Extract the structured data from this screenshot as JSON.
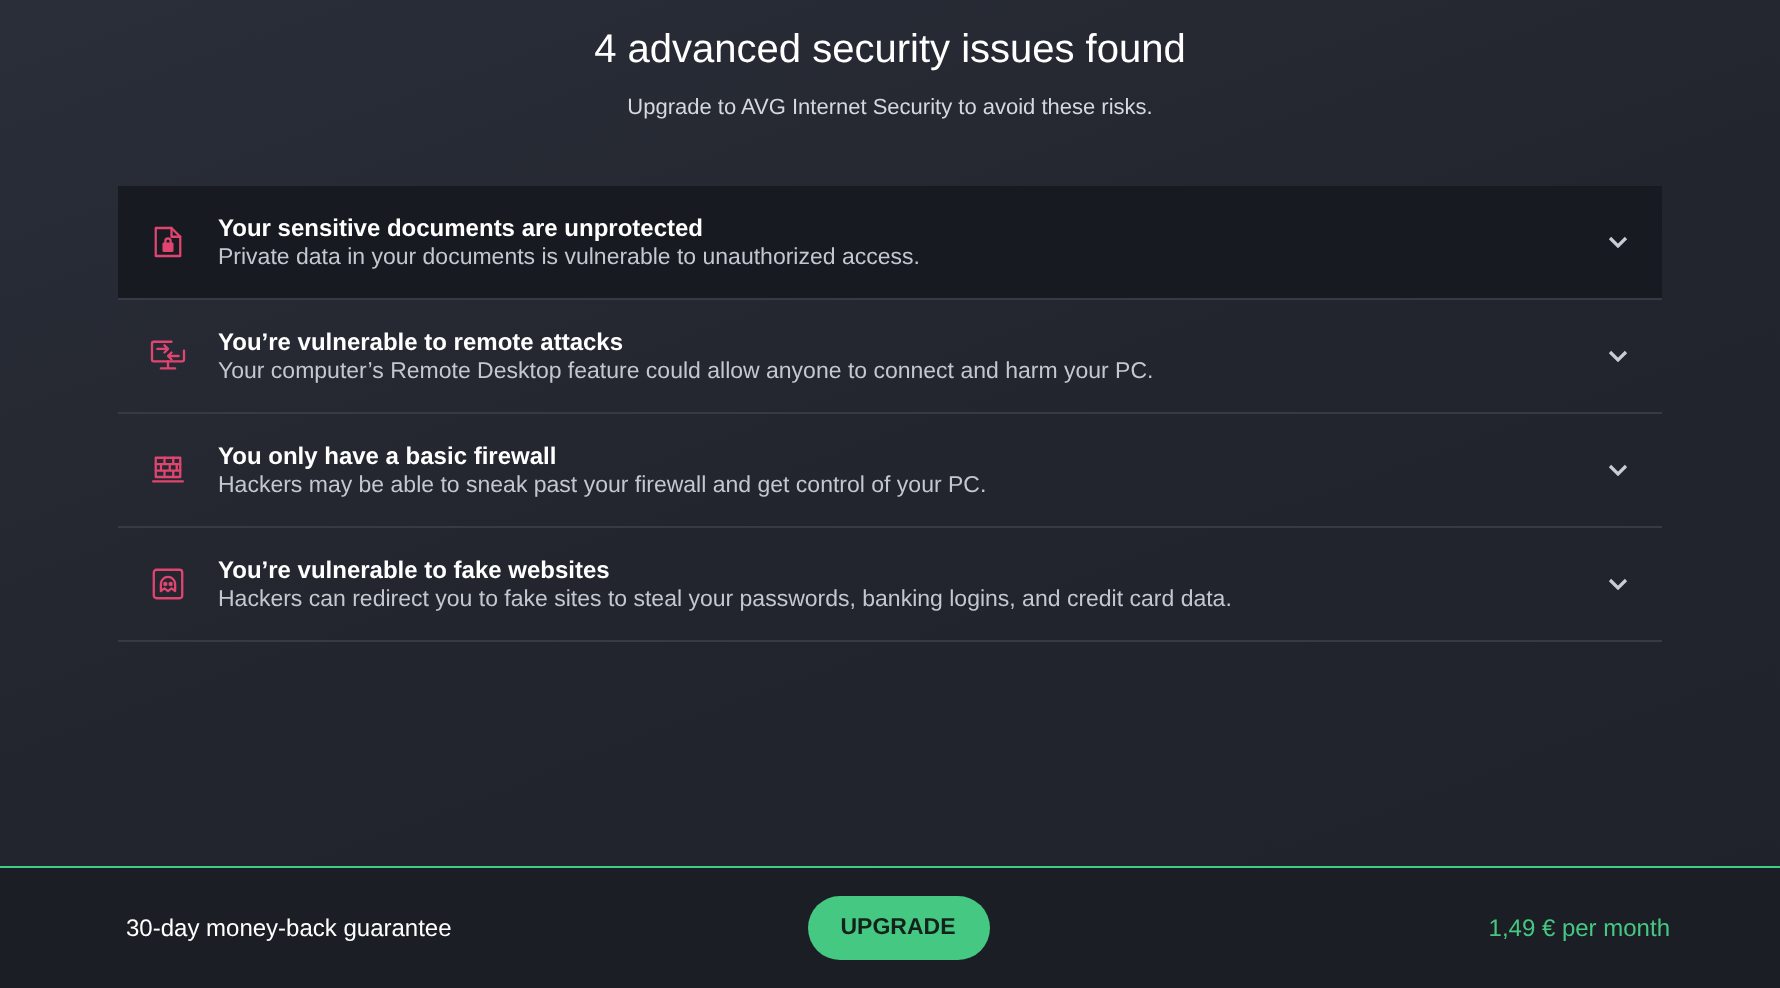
{
  "header": {
    "title": "4 advanced security issues found",
    "subtitle": "Upgrade to AVG Internet Security to avoid these risks."
  },
  "issues": [
    {
      "kind": "document",
      "title": "Your sensitive documents are unprotected",
      "description": "Private data in your documents is vulnerable to unauthorized access.",
      "selected": true,
      "expanded": false
    },
    {
      "kind": "remote",
      "title": "You’re vulnerable to remote attacks",
      "description": "Your computer’s Remote Desktop feature could allow anyone to connect and harm your PC.",
      "selected": false,
      "expanded": false
    },
    {
      "kind": "firewall",
      "title": "You only have a basic firewall",
      "description": "Hackers may be able to sneak past your firewall and get control of your PC.",
      "selected": false,
      "expanded": false
    },
    {
      "kind": "website",
      "title": "You’re vulnerable to fake websites",
      "description": "Hackers can redirect you to fake sites to steal your passwords, banking logins, and credit card data.",
      "selected": false,
      "expanded": false
    }
  ],
  "footer": {
    "guarantee": "30-day money-back guarantee",
    "button": "UPGRADE",
    "price": "1,49 € per month"
  }
}
